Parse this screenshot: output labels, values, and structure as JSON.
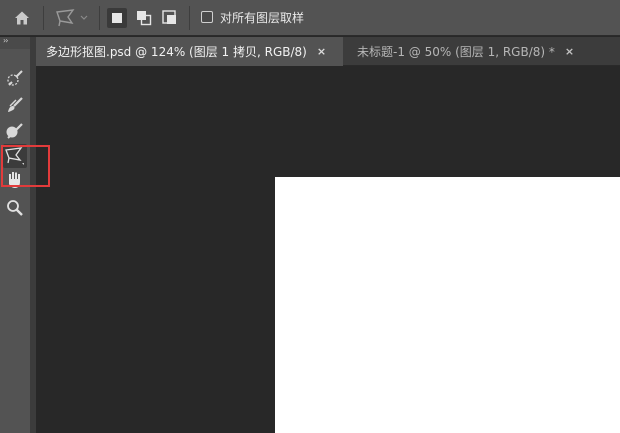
{
  "options_bar": {
    "home_icon": "home-icon",
    "tool_icon": "polygonal-lasso-icon",
    "selection_modes": [
      "new-selection-icon",
      "add-to-selection-icon",
      "subtract-from-selection-icon"
    ],
    "sample_all_layers_label": "对所有图层取样",
    "sample_all_layers_checked": false
  },
  "tabs": [
    {
      "label": "多边形抠图.psd @ 124% (图层 1 拷贝, RGB/8)",
      "close": "×",
      "active": true
    },
    {
      "label": "未标题-1 @ 50% (图层 1, RGB/8) *",
      "close": "×",
      "active": false
    }
  ],
  "toolbar": {
    "collapse_label": "››",
    "tools": [
      "quick-selection-icon",
      "brush-icon",
      "mixer-brush-icon",
      "polygonal-lasso-icon",
      "hand-icon",
      "zoom-icon"
    ],
    "active_tool": "polygonal-lasso-icon",
    "highlight_color": "#e23b3b"
  },
  "colors": {
    "panel": "#535353",
    "workspace": "#282828",
    "document": "#ffffff"
  }
}
